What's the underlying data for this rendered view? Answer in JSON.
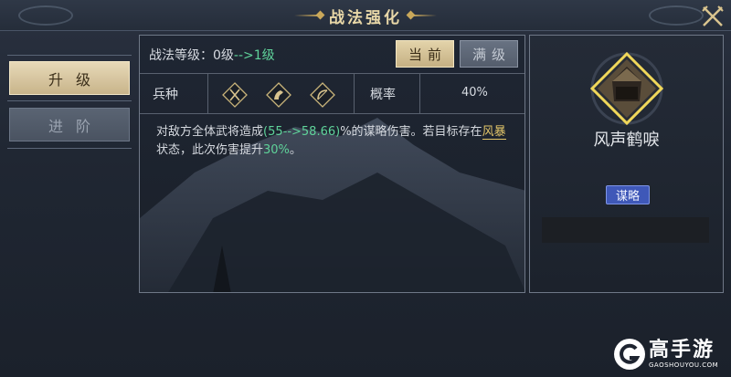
{
  "header": {
    "title": "战法强化",
    "close_icon": "crossed-swords-close-icon"
  },
  "left_nav": {
    "upgrade_label": "升级",
    "advance_label": "进阶"
  },
  "main": {
    "level_label": "战法等级：",
    "level_from": "0级",
    "level_arrow": "-->",
    "level_to": "1级",
    "current_button": "当前",
    "max_button": "满级",
    "troop_label": "兵种",
    "troop_icons": [
      "spear-cavalry-icon",
      "horse-cavalry-icon",
      "bow-archer-icon"
    ],
    "rate_label": "概率",
    "rate_value": "40%",
    "description": {
      "part1": "对敌方全体武将造成",
      "range": "(55-->58.66)",
      "part2": "%的谋略伤害。若目标存在",
      "keyword": "风暴",
      "part3": "状态，此次伤害提升",
      "bonus": "30%",
      "part4": "。"
    }
  },
  "skill": {
    "name": "风声鹤唳",
    "type_badge": "谋略",
    "icon": "fortress-skill-icon"
  },
  "watermark": {
    "brand": "高手游",
    "url": "GAOSHOUYOU.COM"
  },
  "colors": {
    "accent_gold": "#e3d3aa",
    "highlight_green": "#5fd39a",
    "keyword_gold": "#e4c76a",
    "badge_blue": "#3f58b8"
  }
}
